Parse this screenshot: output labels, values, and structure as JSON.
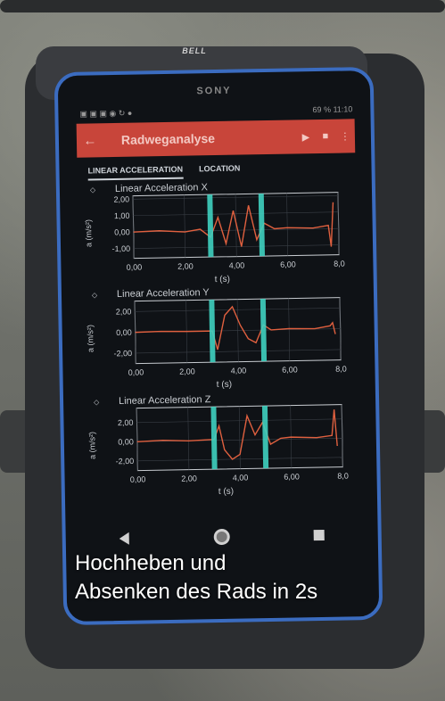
{
  "phone": {
    "brand_holder": "BELL",
    "brand_phone": "SONY",
    "status_left": "▣ ▣ ▣ ◉ ↻ ●",
    "battery": "69 %",
    "time": "11:10"
  },
  "app": {
    "title": "Radweganalyse",
    "back_icon": "arrow-left-icon",
    "play_icon": "play-icon",
    "delete_icon": "trash-icon",
    "menu_icon": "more-vert-icon",
    "accent": "#c8453a",
    "tabs": [
      {
        "label": "LINEAR ACCELERATION"
      },
      {
        "label": "LOCATION"
      }
    ]
  },
  "caption": {
    "line1": "Hochheben und",
    "line2": "Absenken des Rads in 2s"
  },
  "chart_data": [
    {
      "type": "line",
      "title": "Linear Acceleration X",
      "xlabel": "t (s)",
      "ylabel": "a (m/s²)",
      "xlim": [
        0,
        8
      ],
      "ylim": [
        -1.6,
        2.2
      ],
      "xticks": [
        "0,00",
        "2,00",
        "4,00",
        "6,00",
        "8,0"
      ],
      "yticks": [
        "2,00",
        "1,00",
        "0,00",
        "-1,00"
      ],
      "marker_lines": [
        3.0,
        5.0
      ],
      "x": [
        0,
        1,
        2,
        2.6,
        3.0,
        3.3,
        3.6,
        3.9,
        4.2,
        4.5,
        4.8,
        5.1,
        5.5,
        6.0,
        7.0,
        7.6,
        7.7,
        7.8
      ],
      "values": [
        0.0,
        0.05,
        -0.05,
        0.1,
        -0.4,
        0.8,
        -0.8,
        1.2,
        -1.0,
        1.5,
        -0.6,
        0.4,
        0.05,
        0.1,
        0.05,
        0.2,
        -1.1,
        1.6
      ]
    },
    {
      "type": "line",
      "title": "Linear Acceleration Y",
      "xlabel": "t (s)",
      "ylabel": "a (m/s²)",
      "xlim": [
        0,
        8
      ],
      "ylim": [
        -3,
        3
      ],
      "xticks": [
        "0,00",
        "2,00",
        "4,00",
        "6,00",
        "8,0"
      ],
      "yticks": [
        "2,00",
        "0,00",
        "-2,00"
      ],
      "marker_lines": [
        3.0,
        5.0
      ],
      "x": [
        0,
        1,
        2,
        3.0,
        3.2,
        3.5,
        3.8,
        4.1,
        4.4,
        4.7,
        5.0,
        5.3,
        6.0,
        7.0,
        7.6,
        7.7,
        7.8
      ],
      "values": [
        0.0,
        0.05,
        0.0,
        0.0,
        -1.8,
        1.5,
        2.3,
        0.5,
        -0.8,
        -1.2,
        0.5,
        0.0,
        0.1,
        0.05,
        0.3,
        0.6,
        -0.5
      ]
    },
    {
      "type": "line",
      "title": "Linear Acceleration Z",
      "xlabel": "t (s)",
      "ylabel": "a (m/s²)",
      "xlim": [
        0,
        8
      ],
      "ylim": [
        -3,
        3.5
      ],
      "xticks": [
        "0,00",
        "2,00",
        "4,00",
        "6,00",
        "8,0"
      ],
      "yticks": [
        "2,00",
        "0,00",
        "-2,00"
      ],
      "marker_lines": [
        3.0,
        5.0
      ],
      "x": [
        0,
        1,
        2,
        3.0,
        3.2,
        3.4,
        3.7,
        4.0,
        4.3,
        4.6,
        4.9,
        5.2,
        5.6,
        6.0,
        7.0,
        7.6,
        7.7,
        7.8
      ],
      "values": [
        0.0,
        0.1,
        0.0,
        0.1,
        1.5,
        -1.0,
        -2.0,
        -1.5,
        2.5,
        0.5,
        1.8,
        -0.5,
        0.1,
        0.2,
        0.1,
        0.3,
        3.0,
        -0.8
      ]
    }
  ]
}
